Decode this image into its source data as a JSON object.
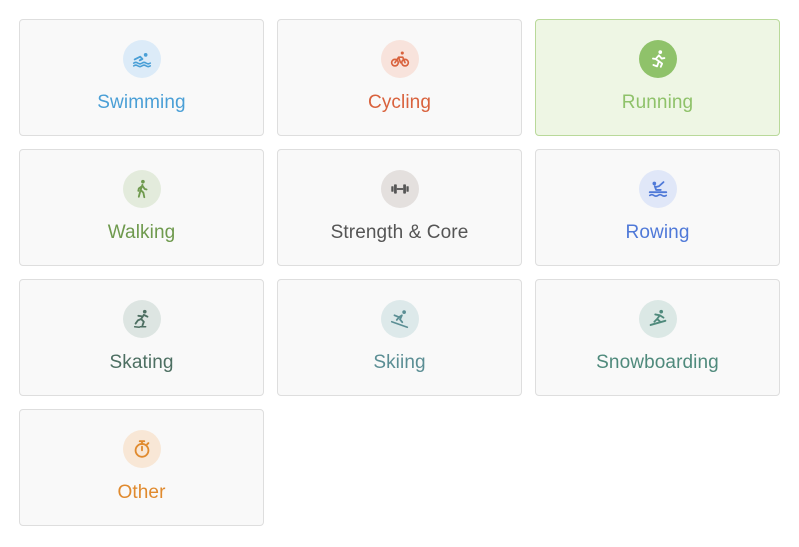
{
  "activities": [
    {
      "label": "Swimming",
      "icon": "swimming-icon",
      "color": "#4a9fd6",
      "icon_bg": "#dcebf8",
      "selected": false
    },
    {
      "label": "Cycling",
      "icon": "cycling-icon",
      "color": "#d9623d",
      "icon_bg": "#f8e3dc",
      "selected": false
    },
    {
      "label": "Running",
      "icon": "running-icon",
      "color": "#8fc26a",
      "icon_bg": "#8fc26a",
      "icon_fg": "#ffffff",
      "selected": true
    },
    {
      "label": "Walking",
      "icon": "walking-icon",
      "color": "#6f9a4e",
      "icon_bg": "#e3ebdc",
      "selected": false
    },
    {
      "label": "Strength & Core",
      "icon": "dumbbell-icon",
      "color": "#555555",
      "icon_bg": "#e4e0de",
      "selected": false
    },
    {
      "label": "Rowing",
      "icon": "rowing-icon",
      "color": "#4f79d8",
      "icon_bg": "#e0e7f8",
      "selected": false
    },
    {
      "label": "Skating",
      "icon": "skating-icon",
      "color": "#4d6f62",
      "icon_bg": "#dde5e2",
      "selected": false
    },
    {
      "label": "Skiing",
      "icon": "skiing-icon",
      "color": "#5b8e94",
      "icon_bg": "#dde9ea",
      "selected": false
    },
    {
      "label": "Snowboarding",
      "icon": "snowboarding-icon",
      "color": "#4f8a7c",
      "icon_bg": "#dbe8e5",
      "selected": false
    },
    {
      "label": "Other",
      "icon": "stopwatch-icon",
      "color": "#e08a2e",
      "icon_bg": "#f8e7d6",
      "selected": false
    }
  ]
}
